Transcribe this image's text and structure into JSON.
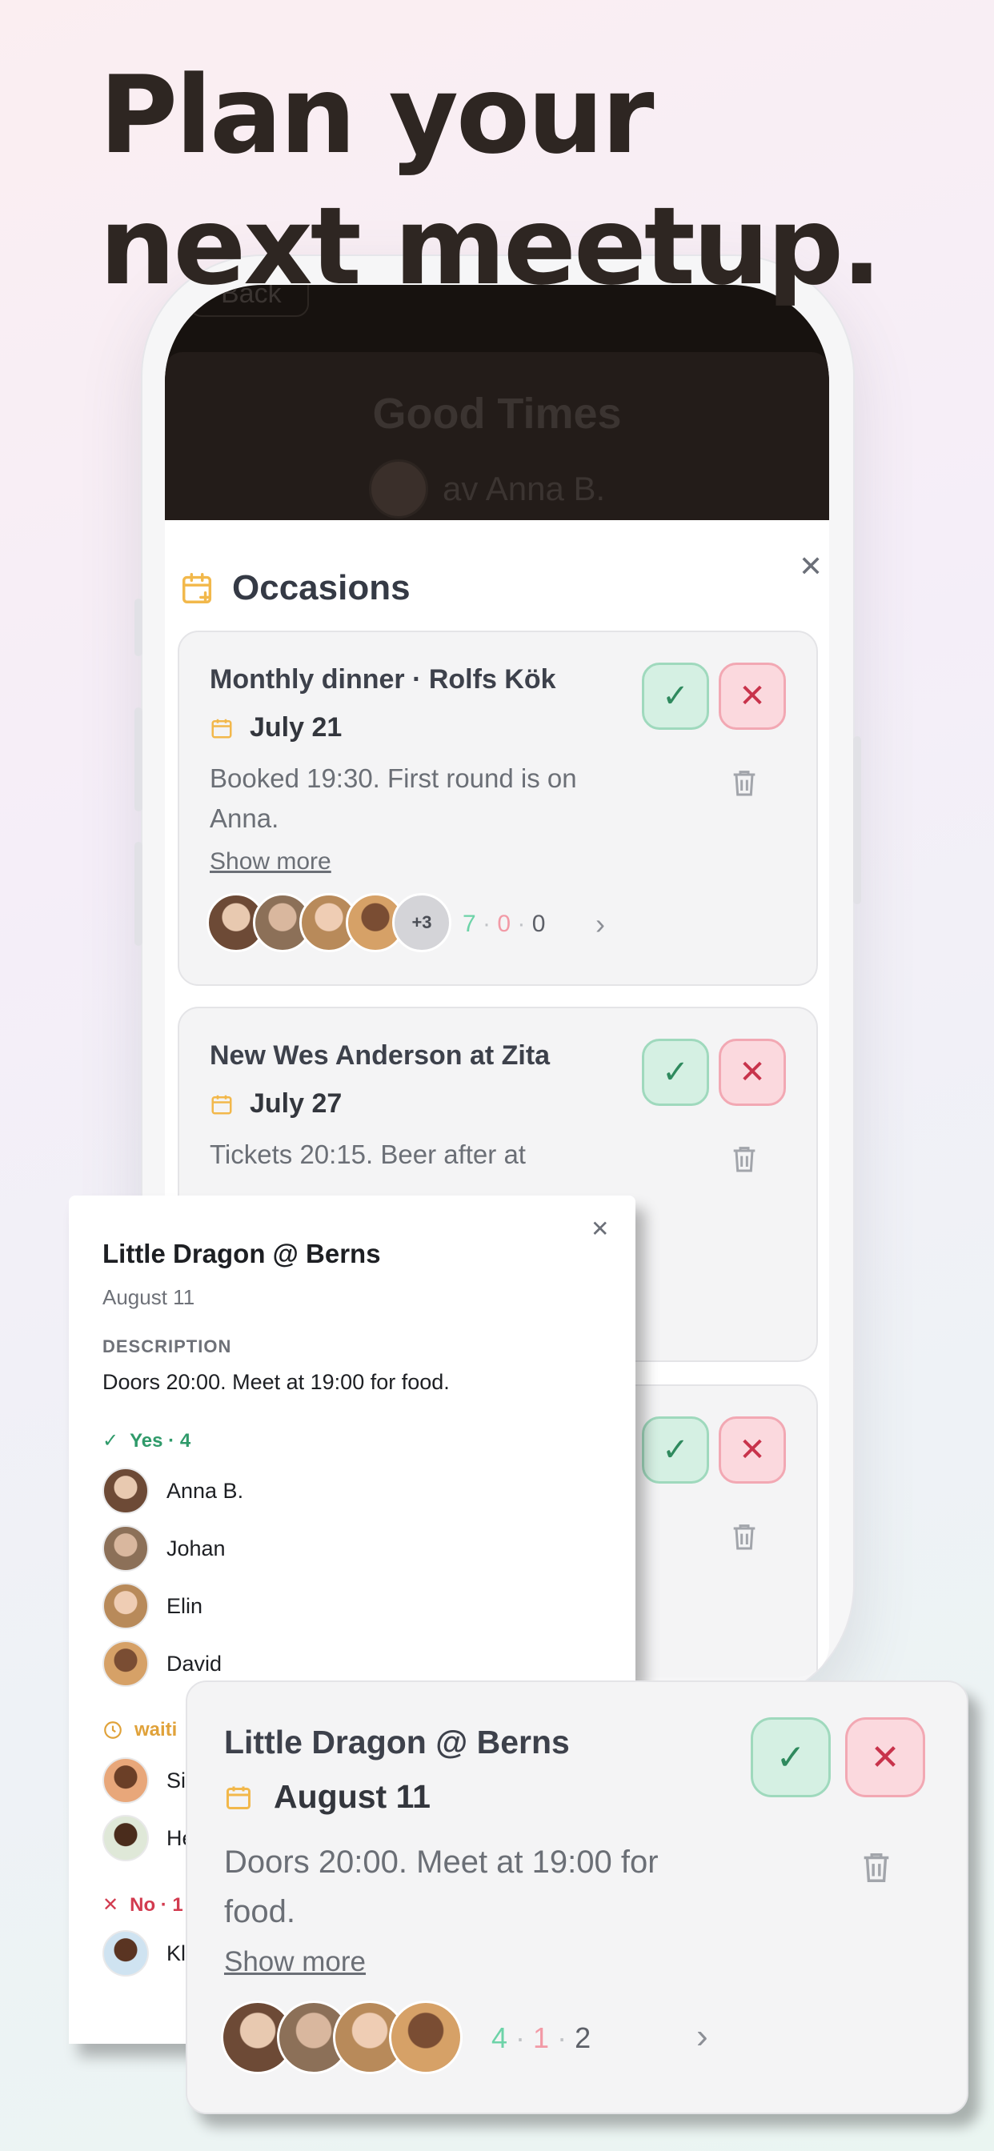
{
  "headline": {
    "line1": "Plan your",
    "line2": "next meetup."
  },
  "app": {
    "back_label": "Back",
    "title": "Good Times",
    "author": "av Anna B."
  },
  "sheet": {
    "title": "Occasions"
  },
  "occasions": [
    {
      "title": "Monthly dinner · Rolfs Kök",
      "date": "July 21",
      "desc": "Booked 19:30. First round is on Anna.",
      "more": "Show more",
      "extra": "+3",
      "yes": "7",
      "no": "0",
      "wait": "0"
    },
    {
      "title": "New Wes Anderson at Zita",
      "date": "July 27",
      "desc": "Tickets 20:15. Beer after at"
    }
  ],
  "detail": {
    "title": "Little Dragon @ Berns",
    "date": "August 11",
    "desc_label": "DESCRIPTION",
    "desc": "Doors 20:00. Meet at 19:00 for food.",
    "yes_label": "Yes · 4",
    "yes_people": [
      "Anna B.",
      "Johan",
      "Elin",
      "David"
    ],
    "wait_label": "waiti",
    "wait_people": [
      "Si",
      "He"
    ],
    "no_label": "No · 1",
    "no_people": [
      "Kl"
    ]
  },
  "front": {
    "title": "Little Dragon @ Berns",
    "date": "August 11",
    "desc": "Doors 20:00. Meet at 19:00 for food.",
    "more": "Show more",
    "yes": "4",
    "no": "1",
    "wait": "2"
  },
  "colors": {
    "yes": "#6dd3a8",
    "no": "#f29aa6",
    "wait": "#5d6068",
    "accent": "#f2b84b"
  }
}
